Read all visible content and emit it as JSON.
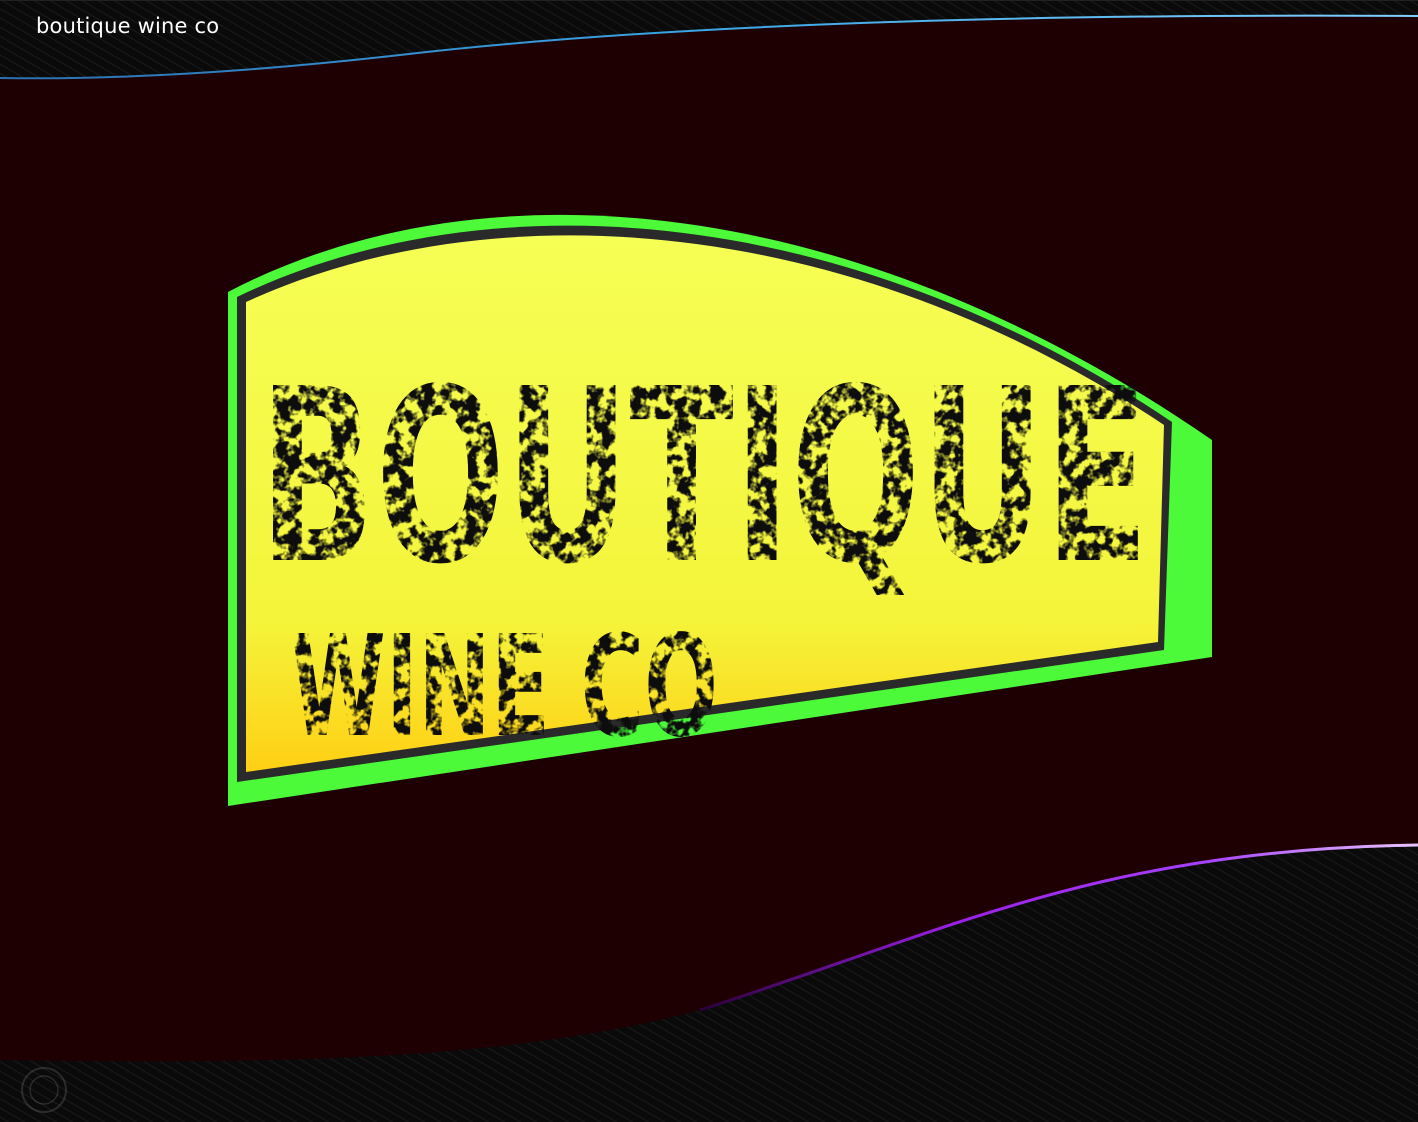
{
  "header": {
    "title": "boutique wine co"
  },
  "logo": {
    "line1": "BOUTIQUE",
    "line2": "WINE CO"
  },
  "colors": {
    "background": "#1e0003",
    "banner_top": "#0a0a0a",
    "accent_blue": "#3ba7e6",
    "accent_purple": "#9b1fe6",
    "sign_green": "#4cfa3a",
    "sign_yellow": "#f3ff48",
    "sign_yellow_bottom": "#ffd21a",
    "lettering": "#0b0b0b"
  },
  "icons": {
    "corner": "watermark-seal-icon"
  }
}
